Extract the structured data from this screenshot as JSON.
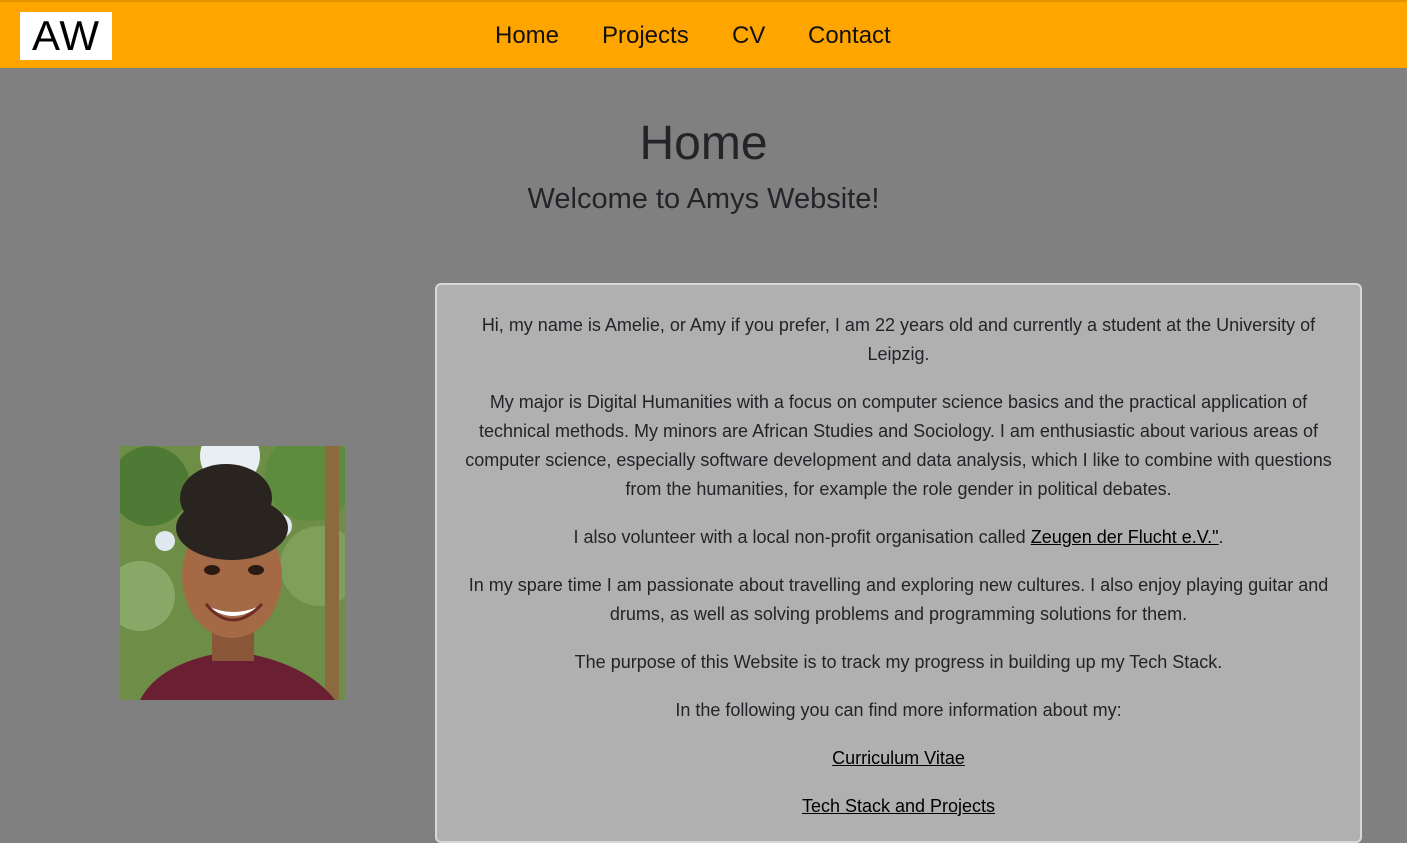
{
  "header": {
    "logo_text": "AW",
    "nav": {
      "home": "Home",
      "projects": "Projects",
      "cv": "CV",
      "contact": "Contact"
    },
    "background_color": "#ffa500"
  },
  "main": {
    "title": "Home",
    "subtitle": "Welcome to Amys Website!",
    "intro": "Hi, my name is Amelie, or Amy if you prefer, I am 22 years old and currently a student at the University of Leipzig.",
    "major": "My major is Digital Humanities with a focus on computer science basics and the practical application of technical methods. My minors are African Studies and Sociology. I am enthusiastic about various areas of computer science, especially software development and data analysis, which I like to combine with questions from the humanities, for example the role gender in political debates.",
    "volunteer_prefix": "I also volunteer with a local non-profit organisation called ",
    "volunteer_link": "Zeugen der Flucht e.V.\"",
    "volunteer_suffix": ".",
    "spare_time": "In my spare time I am passionate about travelling and exploring new cultures. I also enjoy playing guitar and drums, as well as solving problems and programming solutions for them.",
    "purpose": "The purpose of this Website is to track my progress in building up my Tech Stack.",
    "more_info": "In the following you can find more information about my:",
    "cv_link": "Curriculum Vitae",
    "projects_link": "Tech Stack and Projects"
  },
  "colors": {
    "page_background": "#808080",
    "card_background": "#b0b0b0"
  }
}
